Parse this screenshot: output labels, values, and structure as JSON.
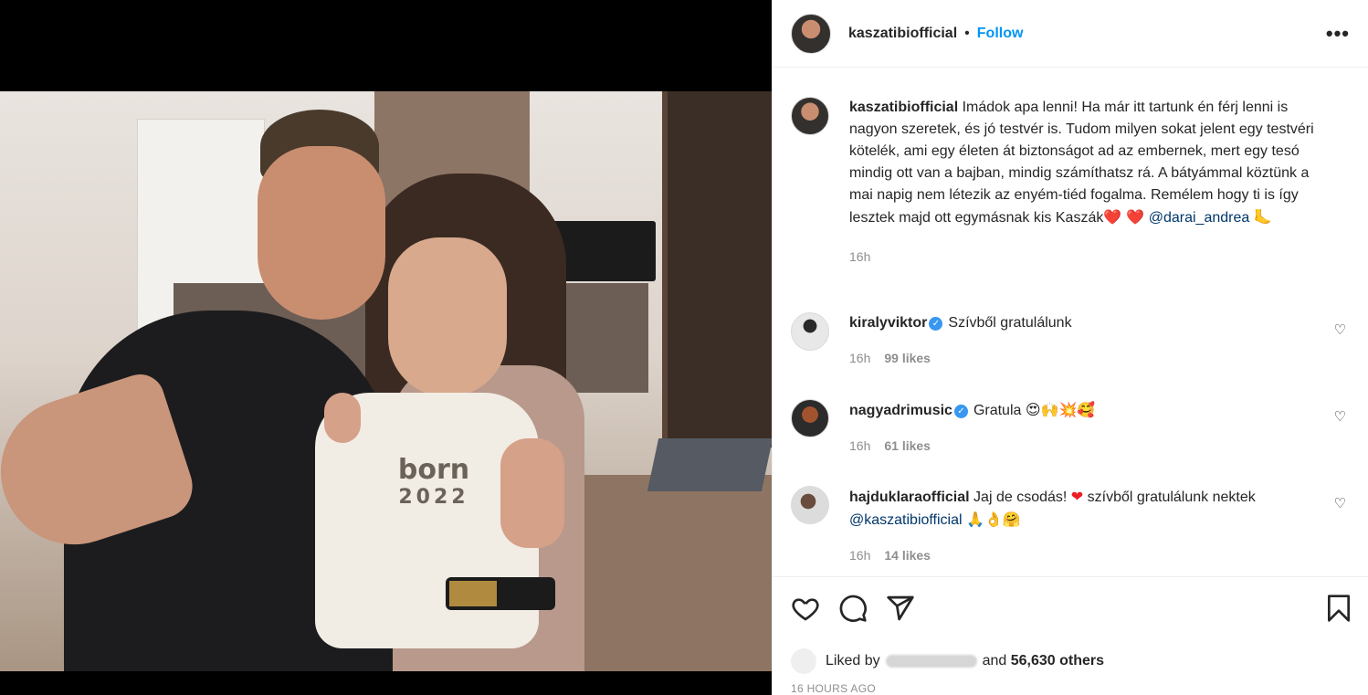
{
  "post": {
    "username": "kaszatibiofficial",
    "follow_label": "Follow",
    "more_label": "•••",
    "image": {
      "onesie_text": "born",
      "onesie_year": "2022"
    }
  },
  "caption": {
    "username": "kaszatibiofficial",
    "text": "Imádok apa lenni! Ha már itt tartunk én férj lenni is nagyon szeretek, és jó testvér is. Tudom milyen sokat jelent egy testvéri kötelék, ami egy életen át biztonságot ad az embernek, mert egy tesó mindig ott van a bajban, mindig számíthatsz rá. A bátyámmal köztünk a mai napig nem létezik az enyém-tiéd fogalma. Remélem hogy ti is így lesztek majd ott egymásnak kis Kaszák",
    "emoji_hearts": "❤️ ❤️",
    "mention": "@darai_andrea",
    "emoji_end": "🦶",
    "time": "16h"
  },
  "comments": [
    {
      "username": "kiralyviktor",
      "verified": true,
      "text": "Szívből gratulálunk",
      "time": "16h",
      "likes": "99 likes"
    },
    {
      "username": "nagyadrimusic",
      "verified": true,
      "text": "Gratula",
      "emoji": "😍🙌💥🥰",
      "time": "16h",
      "likes": "61 likes"
    },
    {
      "username": "hajduklaraofficial",
      "verified": false,
      "text": "Jaj de csodás!",
      "heart": "❤",
      "text2": "szívből gratulálunk nektek",
      "mention": "@kaszatibiofficial",
      "emoji": "🙏👌🤗",
      "time": "16h",
      "likes": "14 likes"
    }
  ],
  "footer": {
    "liked_by_prefix": "Liked by",
    "liked_by_suffix": "and",
    "others": "56,630 others",
    "timestamp": "16 HOURS AGO"
  },
  "colors": {
    "follow": "#0095f6",
    "verified": "#3897f0",
    "muted": "#8e8e8e",
    "mention": "#00376b"
  },
  "icons": [
    "heart-icon",
    "comment-icon",
    "share-icon",
    "bookmark-icon",
    "more-icon",
    "verified-icon"
  ]
}
